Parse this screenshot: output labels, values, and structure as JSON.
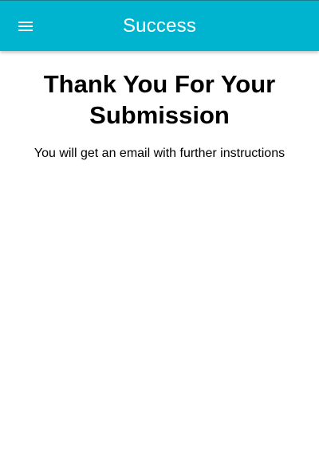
{
  "toolbar": {
    "title": "Success",
    "menu_icon": "hamburger-menu-icon",
    "background_color": "#00b4d0",
    "title_color": "#ffffff"
  },
  "main": {
    "heading": "Thank You For Your Submission",
    "message": "You will get an email with further instructions"
  }
}
